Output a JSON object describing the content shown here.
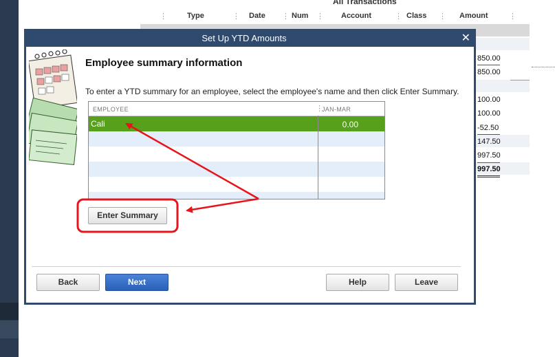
{
  "report": {
    "title": "All Transactions",
    "columns": [
      "Type",
      "Date",
      "Num",
      "Account",
      "Class",
      "Amount"
    ],
    "amounts": [
      "850.00",
      "850.00",
      "100.00",
      "100.00",
      "-52.50",
      "147.50",
      "997.50",
      "997.50"
    ]
  },
  "dialog": {
    "title": "Set Up YTD Amounts",
    "heading": "Employee summary information",
    "instruction": "To enter a YTD summary for an employee, select the employee's name and then click Enter Summary.",
    "grid": {
      "columns": [
        "EMPLOYEE",
        "JAN-MAR"
      ],
      "rows": [
        {
          "employee": "Cali",
          "amount": "0.00",
          "selected": true
        }
      ]
    },
    "buttons": {
      "enter_summary": "Enter Summary",
      "back": "Back",
      "next": "Next",
      "help": "Help",
      "leave": "Leave"
    }
  },
  "colors": {
    "selected_row": "#56a01b",
    "titlebar": "#2f4a6d",
    "primary_button": "#2a60b8",
    "annotation": "#e8141b"
  },
  "icons": {
    "close": "close-icon",
    "art": "calendar-money-illustration"
  }
}
